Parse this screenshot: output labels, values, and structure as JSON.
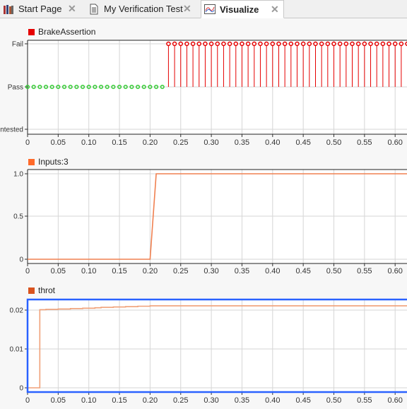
{
  "tabs": [
    {
      "label": "Start Page",
      "icon": "books-icon"
    },
    {
      "label": "My Verification Test",
      "icon": "document-icon"
    },
    {
      "label": "Visualize",
      "icon": "chart-icon",
      "active": true
    }
  ],
  "chart_data": [
    {
      "type": "line",
      "title": "BrakeAssertion",
      "color": "#e60000",
      "xlim": [
        0,
        0.62
      ],
      "yticks": [
        "Untested",
        "Pass",
        "Fail"
      ],
      "xticks": [
        "0",
        "0.05",
        "0.10",
        "0.15",
        "0.20",
        "0.25",
        "0.30",
        "0.35",
        "0.40",
        "0.45",
        "0.50",
        "0.55",
        "0.60"
      ],
      "pass_color": "#33cc33",
      "fail_color": "#e60000",
      "pass_range": [
        0,
        0.22
      ],
      "fail_range": [
        0.23,
        0.62
      ],
      "step": 0.01,
      "grid": true
    },
    {
      "type": "line",
      "title": "Inputs:3",
      "color": "#ff6a2a",
      "line_color": "#f08050",
      "ylim": [
        -0.05,
        1.05
      ],
      "yticks": [
        "0",
        "0.5",
        "1.0"
      ],
      "xticks": [
        "0",
        "0.05",
        "0.10",
        "0.15",
        "0.20",
        "0.25",
        "0.30",
        "0.35",
        "0.40",
        "0.45",
        "0.50",
        "0.55",
        "0.60"
      ],
      "x": [
        0,
        0.2,
        0.21,
        0.62
      ],
      "y": [
        0,
        0,
        1,
        1
      ],
      "grid": true
    },
    {
      "type": "line",
      "title": "throt",
      "color": "#d9531e",
      "line_color": "#f0a078",
      "ylim": [
        -0.0005,
        0.0228
      ],
      "selected": true,
      "border_color": "#2a62ff",
      "yticks": [
        "0",
        "0.01",
        "0.02"
      ],
      "xticks": [
        "0",
        "0.05",
        "0.10",
        "0.15",
        "0.20",
        "0.25",
        "0.30",
        "0.35",
        "0.40",
        "0.45",
        "0.50",
        "0.55",
        "0.60"
      ],
      "x": [
        0,
        0.02,
        0.02,
        0.03,
        0.05,
        0.07,
        0.09,
        0.11,
        0.12,
        0.14,
        0.16,
        0.18,
        0.2,
        0.62
      ],
      "y": [
        0,
        0,
        0.0201,
        0.0202,
        0.0203,
        0.0204,
        0.0205,
        0.0206,
        0.0207,
        0.0208,
        0.0209,
        0.021,
        0.0211,
        0.0211
      ],
      "grid": true
    }
  ]
}
